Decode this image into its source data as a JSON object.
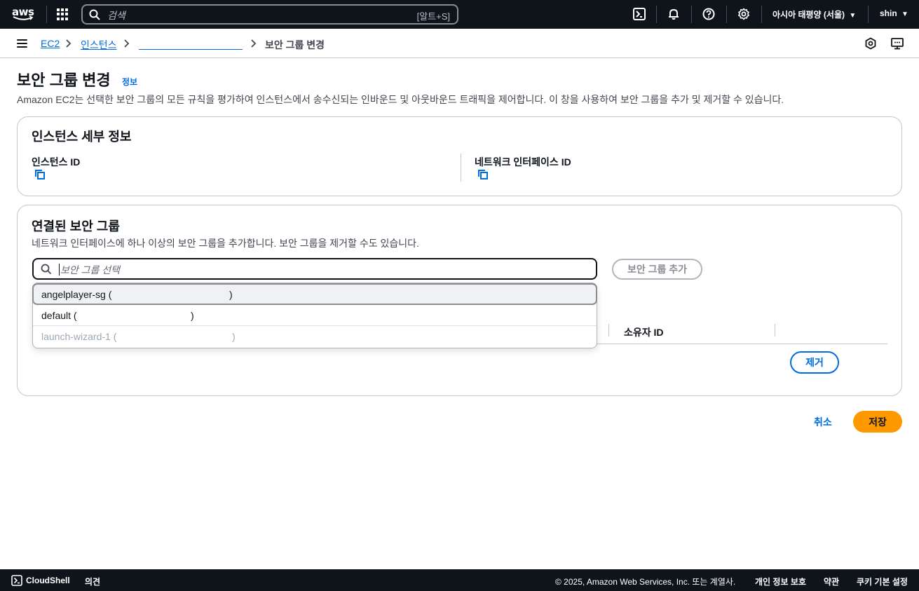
{
  "topnav": {
    "logo_text": "aws",
    "search_placeholder": "검색",
    "search_shortcut": "[알트+S]",
    "region": "아시아 태평양 (서울)",
    "user": "shin",
    "icons": [
      "apps-grid-icon",
      "cloudshell-icon",
      "bell-icon",
      "help-icon",
      "settings-icon"
    ]
  },
  "breadcrumb": {
    "items": [
      {
        "label": "EC2"
      },
      {
        "label": "인스턴스"
      },
      {
        "label": ""
      },
      {
        "label": "보안 그룹 변경"
      }
    ]
  },
  "page": {
    "title": "보안 그룹 변경",
    "info_link": "정보",
    "description": "Amazon EC2는 선택한 보안 그룹의 모든 규칙을 평가하여 인스턴스에서 송수신되는 인바운드 및 아웃바운드 트래픽을 제어합니다. 이 창을 사용하여 보안 그룹을 추가 및 제거할 수 있습니다."
  },
  "instance_details": {
    "title": "인스턴스 세부 정보",
    "instance_id_label": "인스턴스 ID",
    "network_interface_id_label": "네트워크 인터페이스 ID"
  },
  "associated_groups": {
    "title": "연결된 보안 그룹",
    "description": "네트워크 인터페이스에 하나 이상의 보안 그룹을 추가합니다. 보안 그룹을 제거할 수도 있습니다.",
    "select_placeholder": "보안 그룹 선택",
    "add_button": "보안 그룹 추가",
    "owner_id_header": "소유자 ID",
    "remove_button": "제거",
    "options": [
      {
        "name": "angelplayer-sg (",
        "suffix": ")",
        "state": "highlighted"
      },
      {
        "name": "default (",
        "suffix": ")",
        "state": "normal"
      },
      {
        "name": "launch-wizard-1 (",
        "suffix": ")",
        "state": "disabled"
      }
    ]
  },
  "actions": {
    "cancel": "취소",
    "save": "저장"
  },
  "footer": {
    "cloudshell": "CloudShell",
    "feedback": "의견",
    "copyright": "© 2025, Amazon Web Services, Inc. 또는 계열사.",
    "privacy": "개인 정보 보호",
    "terms": "약관",
    "cookies": "쿠키 기본 설정"
  },
  "colors": {
    "nav_bg": "#0f141a",
    "link": "#006ce0",
    "primary_button": "#ff9900",
    "border": "#c6c6cd"
  }
}
